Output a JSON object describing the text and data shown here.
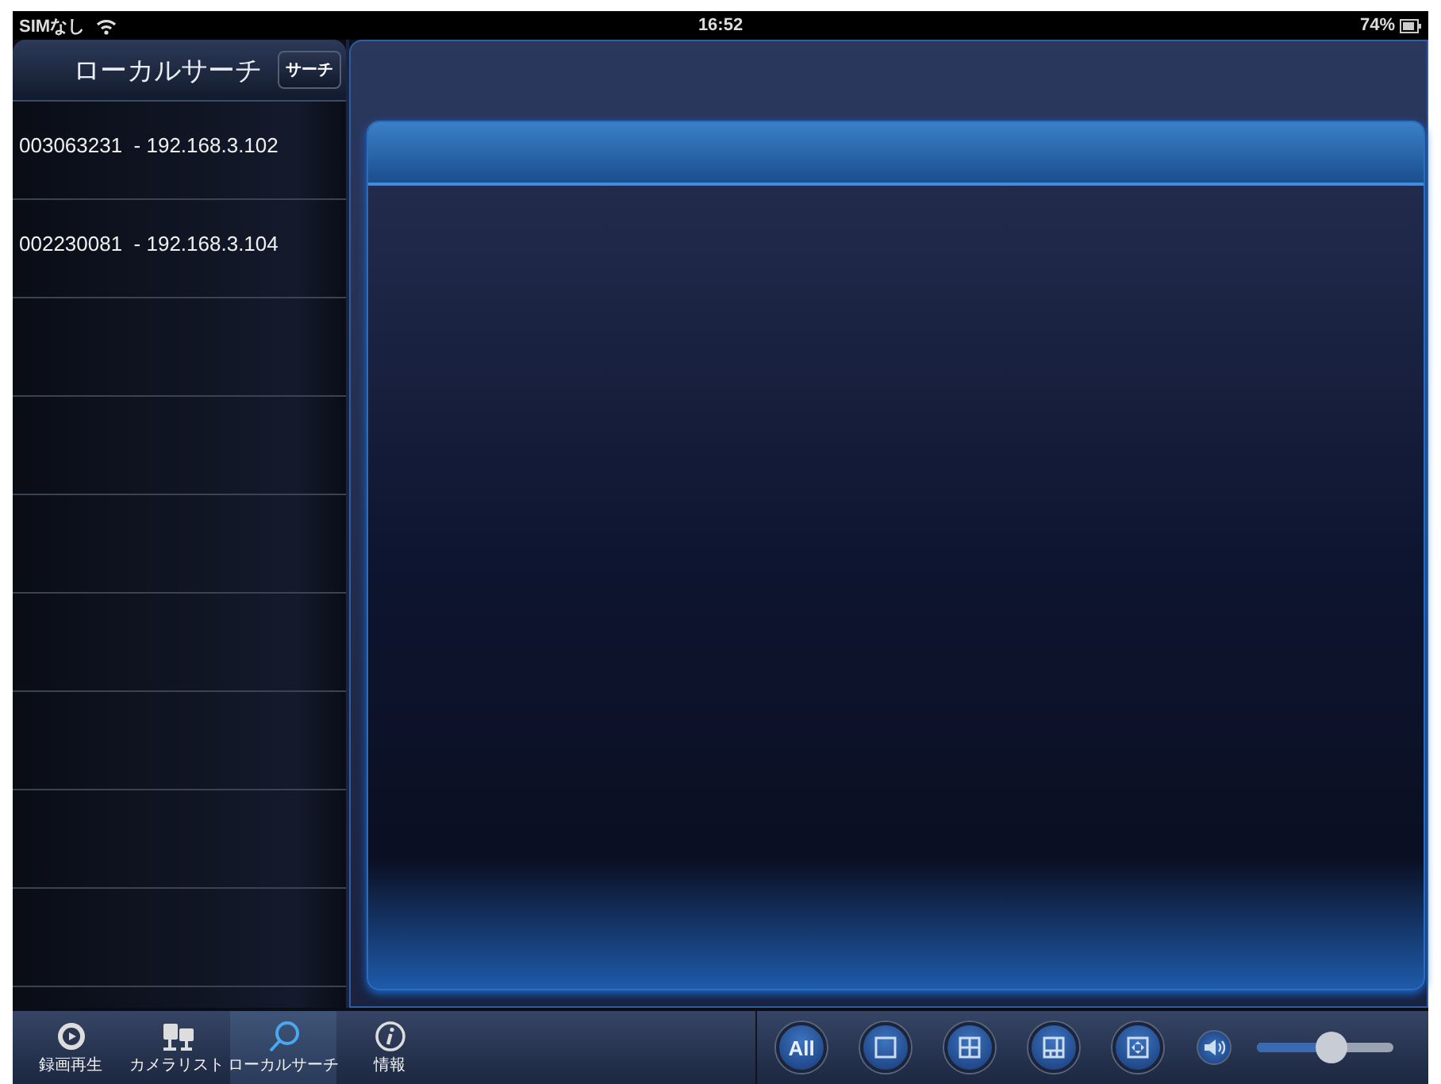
{
  "status_bar": {
    "carrier": "SIMなし",
    "time": "16:52",
    "battery": "74%"
  },
  "sidebar": {
    "title": "ローカルサーチ",
    "search_button": "サーチ",
    "items": [
      {
        "label": "003063231  - 192.168.3.102"
      },
      {
        "label": "002230081  - 192.168.3.104"
      }
    ]
  },
  "tab_bar": {
    "tabs": [
      {
        "label": "録画再生",
        "kind": "playback",
        "selected": false
      },
      {
        "label": "カメラリスト",
        "kind": "cameras",
        "selected": false
      },
      {
        "label": "ローカルサーチ",
        "kind": "search",
        "selected": true
      },
      {
        "label": "情報",
        "kind": "info",
        "selected": false
      }
    ],
    "layout_buttons": [
      {
        "kind": "text",
        "label": "All"
      },
      {
        "kind": "single"
      },
      {
        "kind": "quad"
      },
      {
        "kind": "six"
      },
      {
        "kind": "fullscreen"
      }
    ],
    "volume": {
      "level": 0.55
    }
  }
}
